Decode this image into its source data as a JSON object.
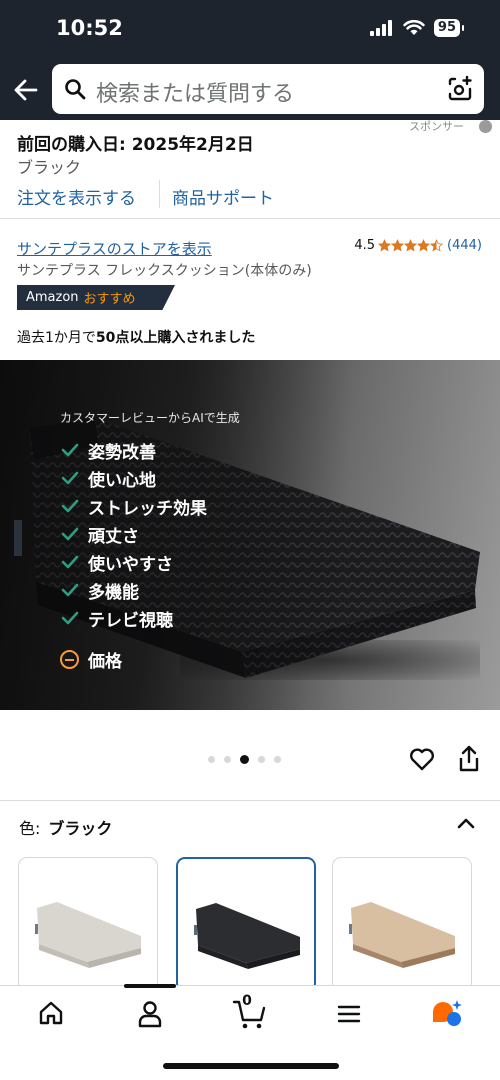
{
  "status": {
    "time": "10:52",
    "battery": "95"
  },
  "search": {
    "placeholder": "検索または質問する"
  },
  "purchase": {
    "sponsor_label": "スポンサー",
    "last_purchase": "前回の購入日: 2025年2月2日",
    "variant": "ブラック",
    "view_order": "注文を表示する",
    "product_support": "商品サポート"
  },
  "product": {
    "store_link": "サンテプラスのストアを表示",
    "rating": "4.5",
    "stars": 4.5,
    "rating_count": "(444)",
    "title": "サンテプラス フレックスクッション(本体のみ)",
    "badge_brand": "Amazon",
    "badge_label": "おすすめ",
    "bought_prefix": "過去1か月で",
    "bought_bold": "50点以上購入されました"
  },
  "hero": {
    "caption": "カスタマーレビューからAIで生成",
    "positives": [
      "姿勢改善",
      "使い心地",
      "ストレッチ効果",
      "頑丈さ",
      "使いやすさ",
      "多機能",
      "テレビ視聴"
    ],
    "negative": "価格"
  },
  "carousel": {
    "count": 5,
    "active_index": 2
  },
  "color": {
    "label": "色:",
    "value": "ブラック",
    "swatches": [
      {
        "name": "white",
        "color": "#d9d6d0",
        "selected": false
      },
      {
        "name": "black",
        "color": "#2b2d31",
        "selected": true
      },
      {
        "name": "beige",
        "color": "#c7a98a",
        "selected": false
      }
    ]
  },
  "nav": {
    "cart_count": "0"
  },
  "colors": {
    "header": "#1d242e",
    "link": "#2162a1",
    "accent": "#ff9900",
    "check": "#2e9d80"
  }
}
